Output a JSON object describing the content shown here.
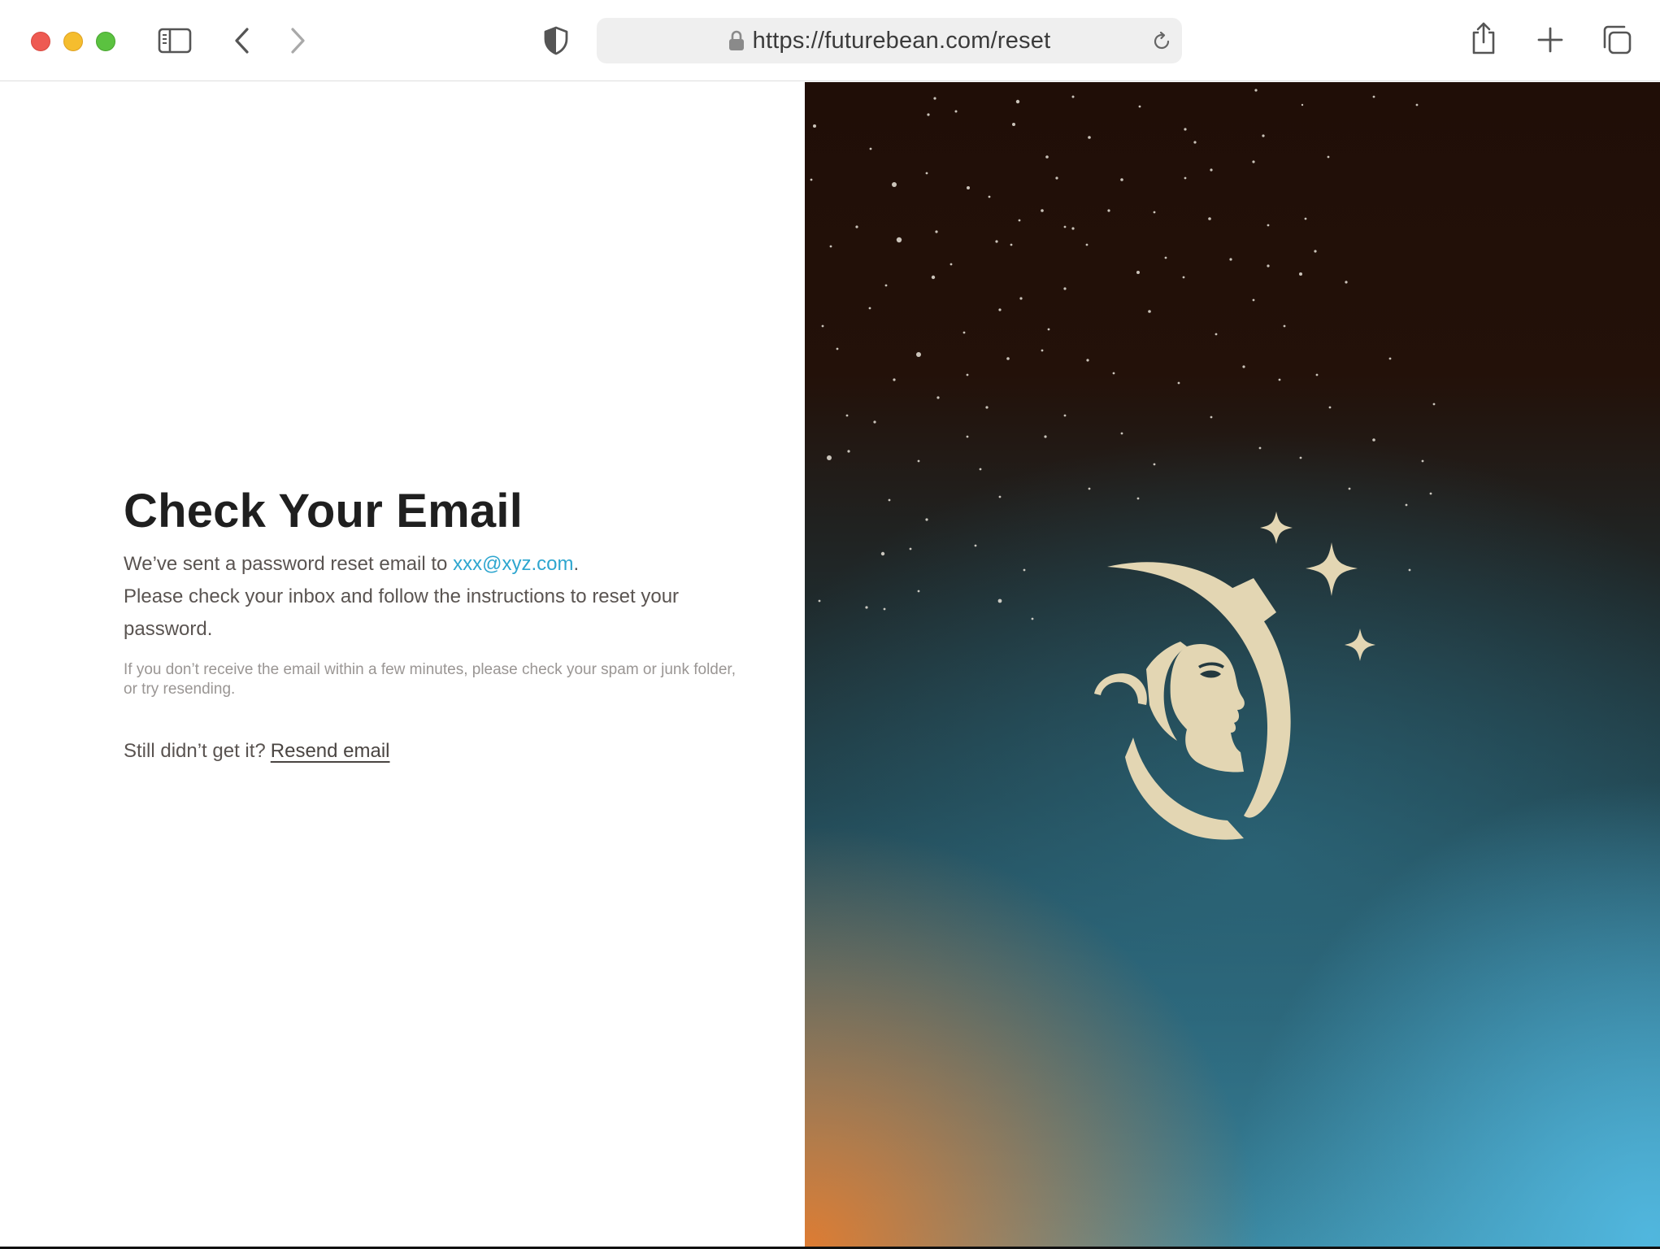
{
  "browser": {
    "url": "https://futurebean.com/reset",
    "icons": {
      "sidebar": "sidebar-toggle-icon",
      "back": "chevron-left-icon",
      "forward": "chevron-right-icon",
      "shield": "privacy-shield-icon",
      "lock": "lock-icon",
      "reload": "reload-icon",
      "share": "share-icon",
      "new_tab": "plus-icon",
      "tabs": "tab-overview-icon"
    }
  },
  "page": {
    "title": "Check Your Email",
    "message_prefix": "We’ve sent a password reset email to ",
    "email": "xxx@xyz.com",
    "message_period": ".",
    "message_line2": "Please check your inbox and follow the instructions to reset your password.",
    "note": "If you don’t receive the email within a few minutes, please check your spam or junk folder, or try resending.",
    "resend_prompt": "Still didn’t get it?",
    "resend_link": "Resend email"
  },
  "colors": {
    "link": "#2ea6cf",
    "logo": "#e3d6b3",
    "sky_top": "#200e07",
    "sky_bottom_right": "#52b9e1",
    "sky_bottom_left": "#de7c32"
  }
}
